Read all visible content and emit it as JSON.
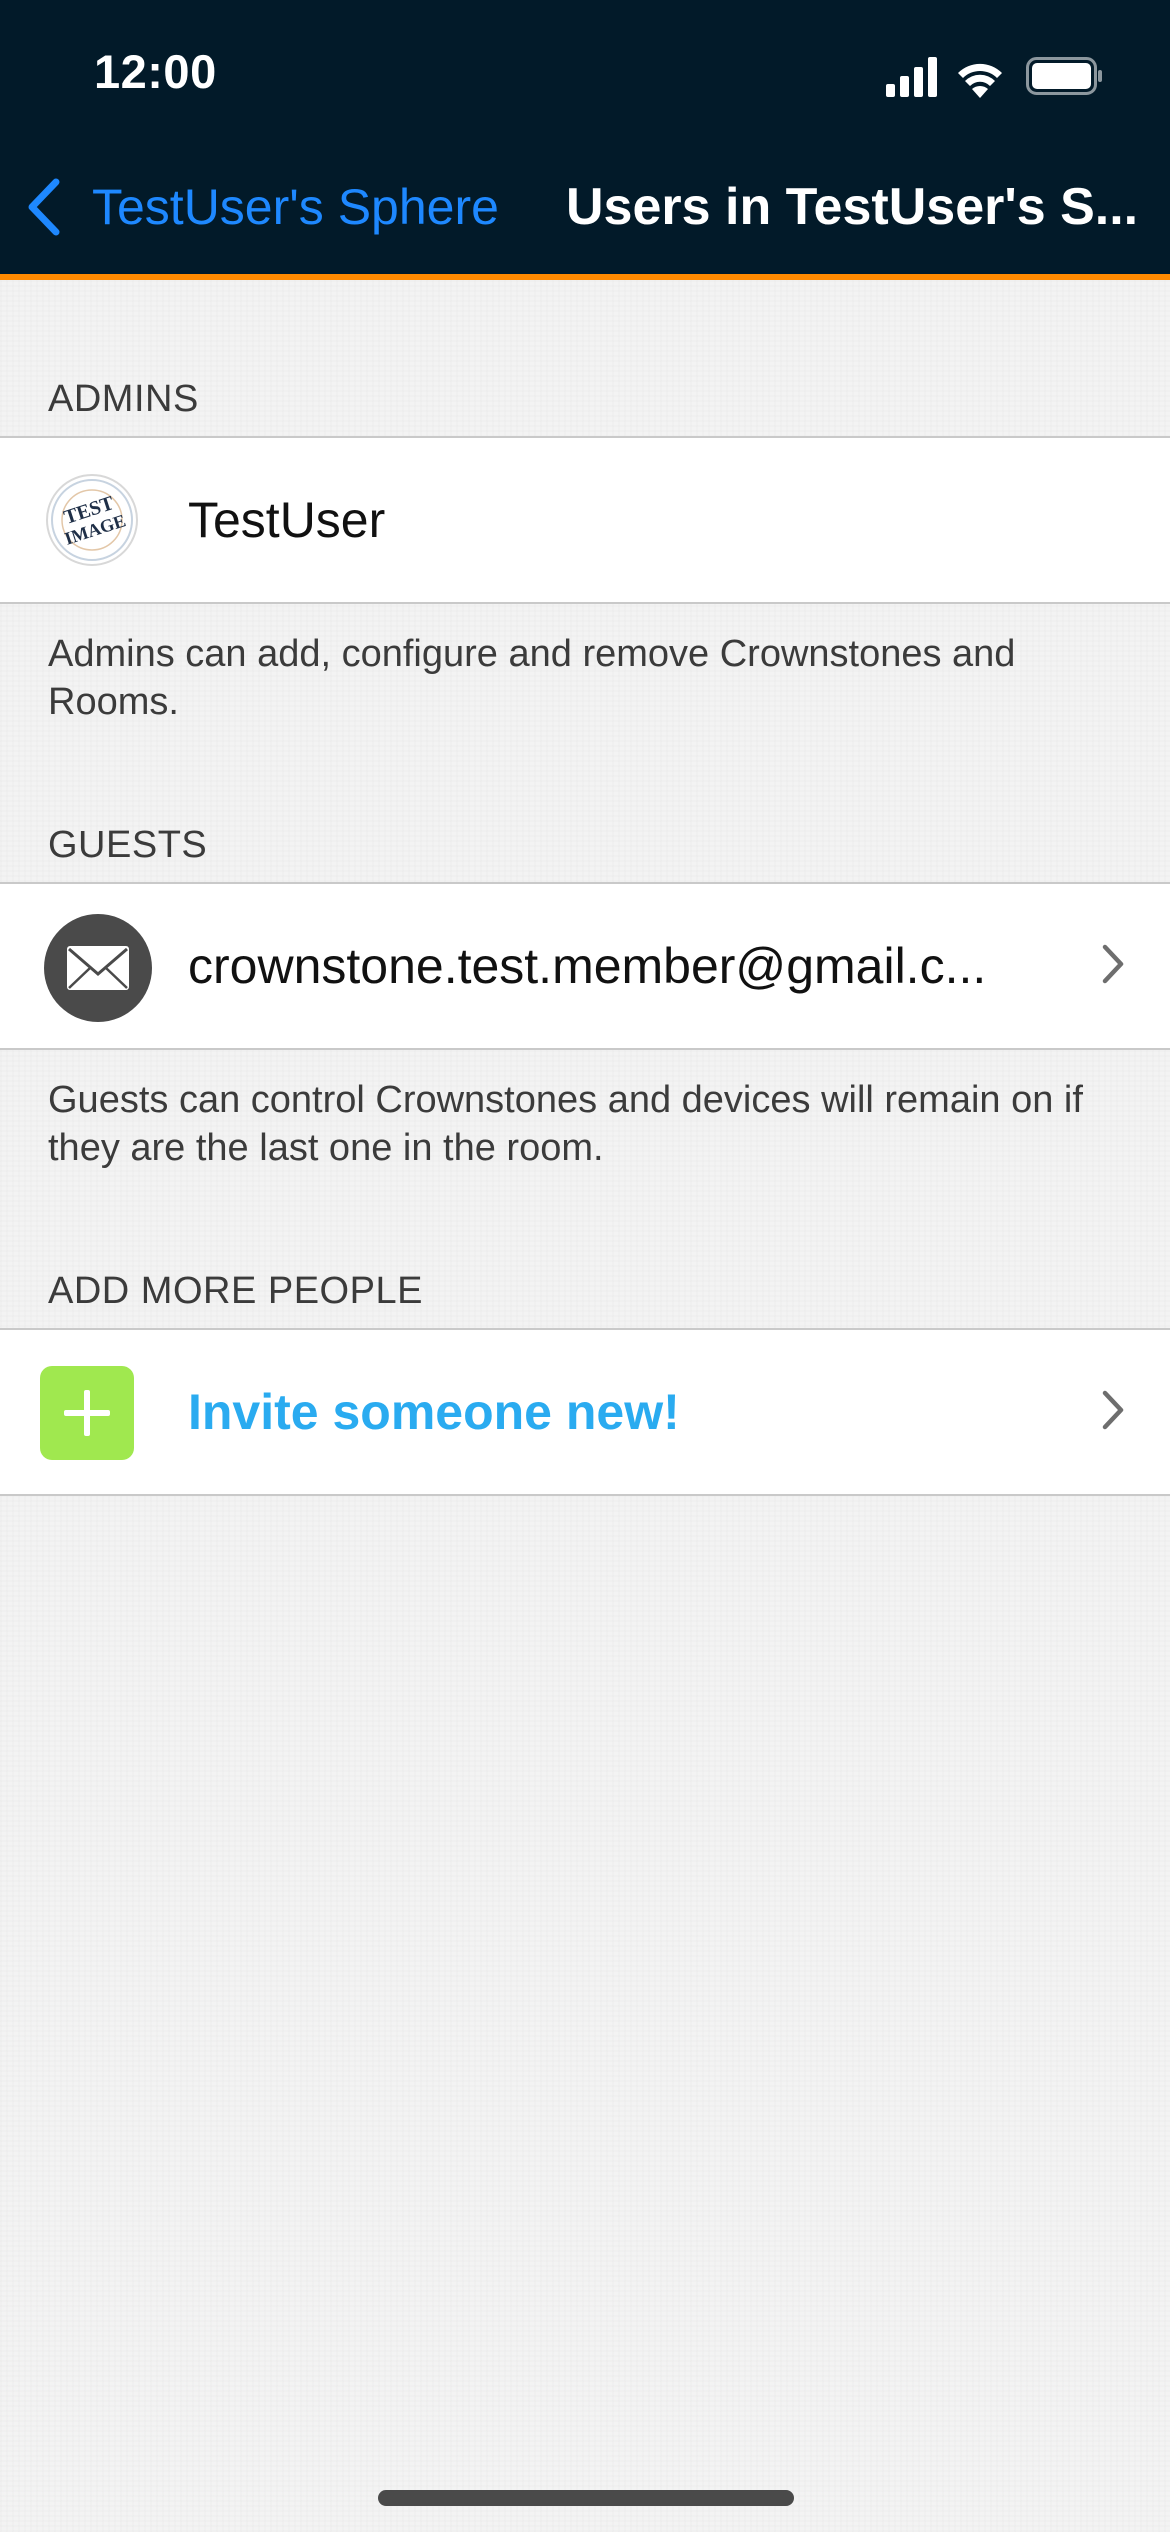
{
  "status_bar": {
    "time": "12:00"
  },
  "nav": {
    "back_label": "TestUser's Sphere",
    "title": "Users in TestUser's S..."
  },
  "sections": {
    "admins": {
      "header": "ADMINS",
      "users": [
        {
          "name": "TestUser",
          "avatar": "test-image-avatar"
        }
      ],
      "footer": "Admins can add, configure and remove Crownstones and Rooms."
    },
    "guests": {
      "header": "GUESTS",
      "users": [
        {
          "name": "crownstone.test.member@gmail.c...",
          "avatar": "envelope-icon"
        }
      ],
      "footer": "Guests can control Crownstones and devices will remain on if they are the last one in the room."
    },
    "add_people": {
      "header": "ADD MORE PEOPLE",
      "invite_label": "Invite someone new!"
    }
  },
  "avatar_text": {
    "line1": "TEST",
    "line2": "IMAGE"
  },
  "colors": {
    "header_bg": "#021a29",
    "accent": "#ff8a00",
    "link_blue": "#1e88ff",
    "invite_blue": "#2aabf0",
    "add_green": "#a0e84f"
  },
  "icons": {
    "back": "chevron-left-icon",
    "chevron": "chevron-right-icon",
    "signal": "cellular-signal-icon",
    "wifi": "wifi-icon",
    "battery": "battery-icon",
    "add": "plus-icon",
    "mail": "envelope-icon"
  }
}
